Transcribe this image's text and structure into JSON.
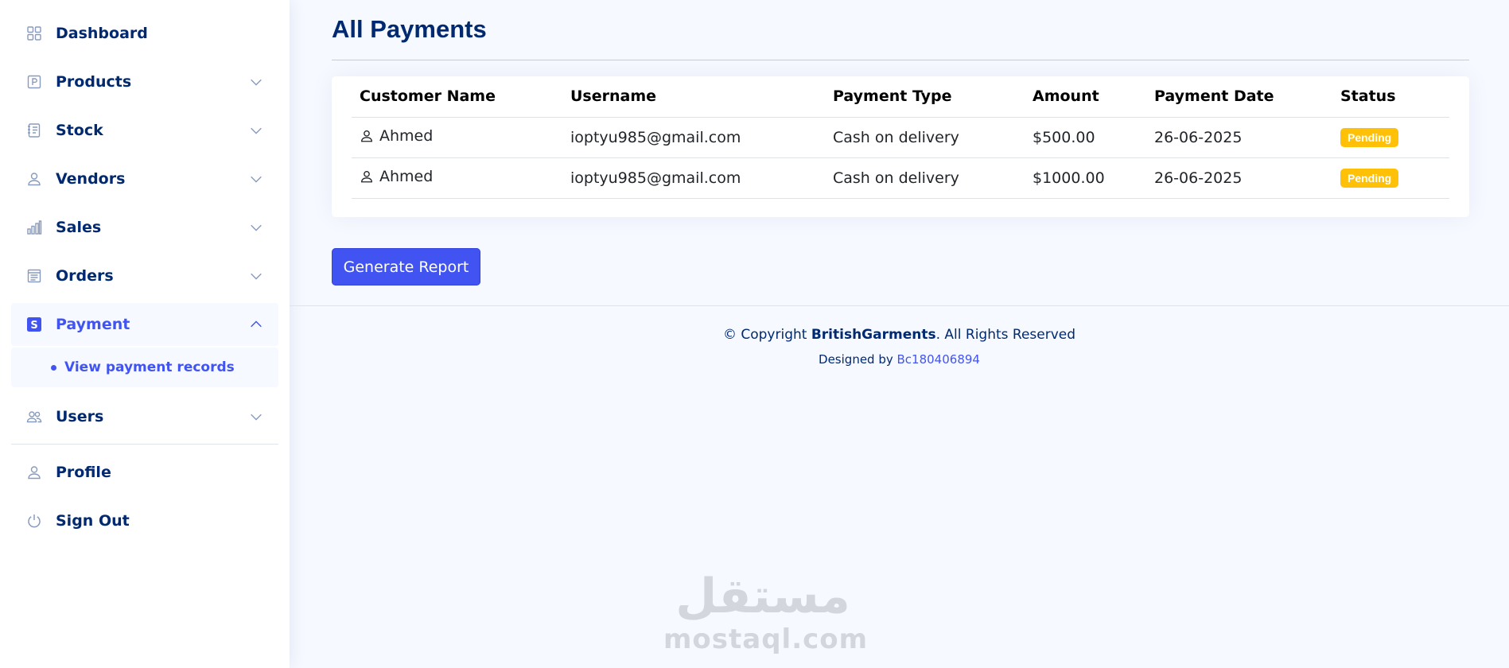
{
  "sidebar": {
    "items": [
      {
        "label": "Dashboard",
        "icon": "grid-icon"
      },
      {
        "label": "Products",
        "icon": "product-icon"
      },
      {
        "label": "Stock",
        "icon": "stock-icon"
      },
      {
        "label": "Vendors",
        "icon": "person-icon"
      },
      {
        "label": "Sales",
        "icon": "bar-chart-icon"
      },
      {
        "label": "Orders",
        "icon": "orders-icon"
      },
      {
        "label": "Payment",
        "icon": "payment-icon"
      },
      {
        "label": "Users",
        "icon": "users-icon"
      },
      {
        "label": "Profile",
        "icon": "person-icon"
      },
      {
        "label": "Sign Out",
        "icon": "power-icon"
      }
    ],
    "payment_sub": {
      "label": "View payment records"
    }
  },
  "main": {
    "title": "All Payments",
    "table": {
      "headers": [
        "Customer Name",
        "Username",
        "Payment Type",
        "Amount",
        "Payment Date",
        "Status"
      ],
      "rows": [
        {
          "customer": "Ahmed",
          "username": "ioptyu985@gmail.com",
          "type": "Cash on delivery",
          "amount": "$500.00",
          "date": "26-06-2025",
          "status": "Pending"
        },
        {
          "customer": "Ahmed",
          "username": "ioptyu985@gmail.com",
          "type": "Cash on delivery",
          "amount": "$1000.00",
          "date": "26-06-2025",
          "status": "Pending"
        }
      ]
    },
    "generate_button": "Generate Report"
  },
  "footer": {
    "copyright_prefix": "© Copyright ",
    "brand": "BritishGarments",
    "copyright_suffix": ". All Rights Reserved",
    "designed_by": "Designed by ",
    "designer": "Bc180406894"
  },
  "watermark": {
    "arabic": "مستقل",
    "latin": "mostaql.com"
  },
  "colors": {
    "primary": "#4154f1",
    "navy": "#012970",
    "pending": "#ffc107",
    "background": "#f6f9ff"
  }
}
